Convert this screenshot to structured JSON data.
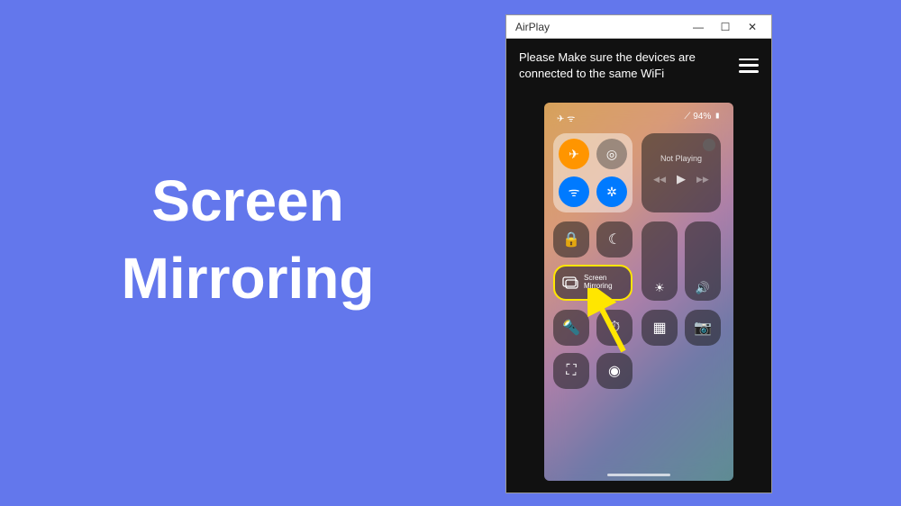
{
  "heading_line1": "Screen",
  "heading_line2": "Mirroring",
  "window": {
    "title": "AirPlay",
    "minimize": "—",
    "maximize": "☐",
    "close": "✕"
  },
  "hint": "Please Make sure the devices are connected to the same WiFi",
  "status": {
    "left": "✈ ᯤ",
    "right": "⟋ 94% ▮"
  },
  "media": {
    "not_playing": "Not Playing",
    "prev": "◀◀",
    "play": "▶",
    "next": "▶▶"
  },
  "tiles": {
    "airplane": "✈",
    "cellular": "◎",
    "wifi": "ᯤ",
    "bluetooth": "✲",
    "lock": "🔒",
    "moon": "☾",
    "brightness": "☀",
    "volume": "🔊",
    "mirror_label": "Screen\nMirroring",
    "flashlight": "🔦",
    "timer": "⏱",
    "calc": "▦",
    "camera": "📷",
    "scan": "⛶",
    "record": "◉"
  },
  "colors": {
    "accent": "#6377ec",
    "highlight": "#ffe600"
  }
}
